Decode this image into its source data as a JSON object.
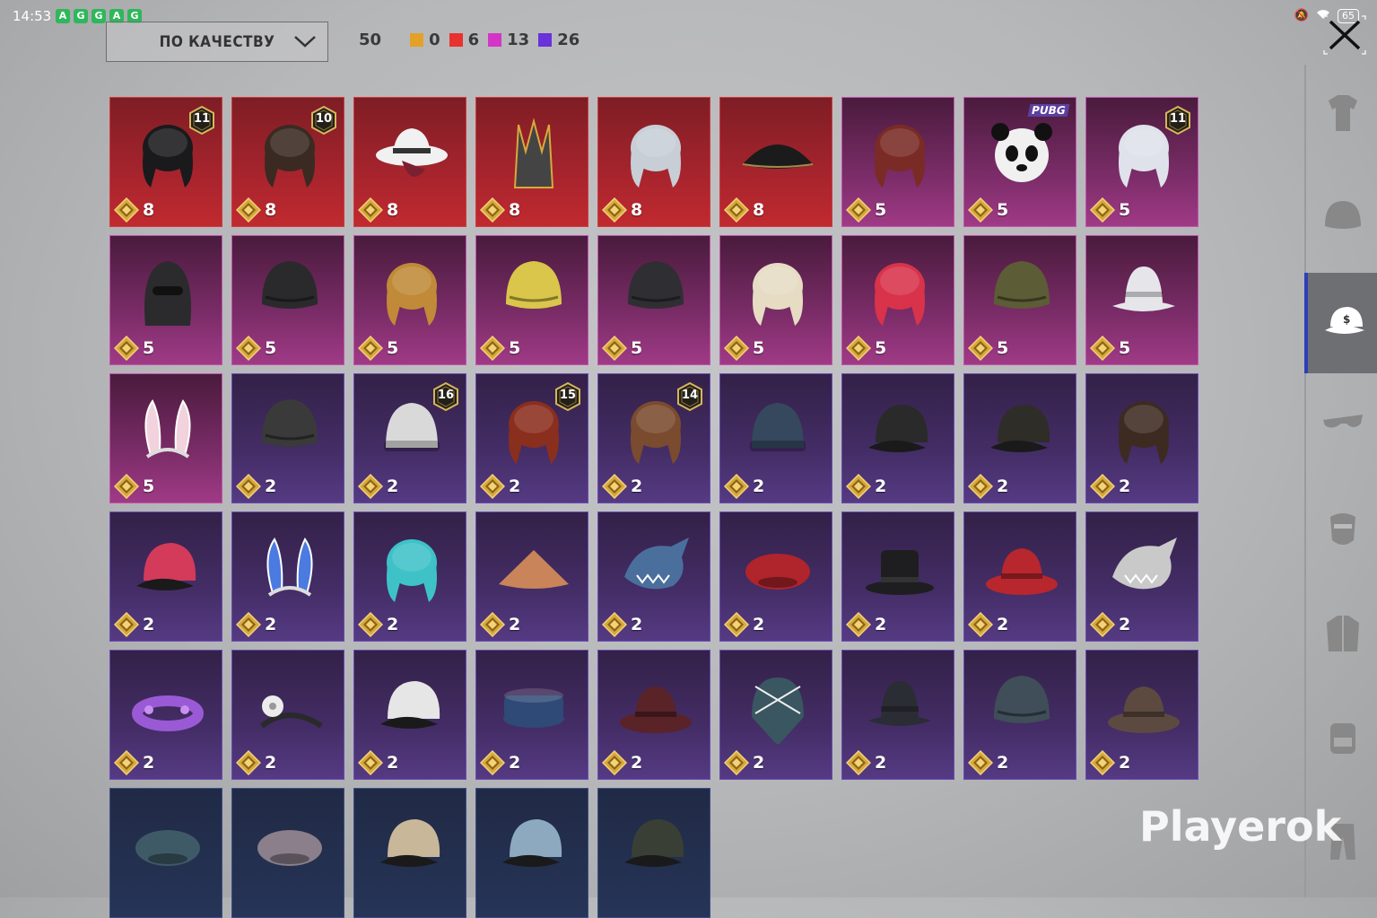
{
  "status_bar": {
    "time": "14:53",
    "app_icons": [
      "A",
      "G",
      "G",
      "A",
      "G"
    ],
    "battery": "65"
  },
  "sort": {
    "label": "ПО КАЧЕСТВУ"
  },
  "counts": {
    "total": "50",
    "groups": [
      {
        "color": "#e3a128",
        "value": "0"
      },
      {
        "color": "#e8322f",
        "value": "6"
      },
      {
        "color": "#d435c6",
        "value": "13"
      },
      {
        "color": "#6a32d8",
        "value": "26"
      }
    ]
  },
  "watermark": "Playerok",
  "sidebar": {
    "items": [
      {
        "icon": "shirt-icon",
        "active": false
      },
      {
        "icon": "helmet-icon",
        "active": false
      },
      {
        "icon": "cap-icon",
        "active": true
      },
      {
        "icon": "glasses-icon",
        "active": false
      },
      {
        "icon": "mask-icon",
        "active": false
      },
      {
        "icon": "jacket-icon",
        "active": false
      },
      {
        "icon": "backpack-icon",
        "active": false
      },
      {
        "icon": "pants-icon",
        "active": false
      }
    ]
  },
  "items": [
    {
      "q": "red",
      "price": "8",
      "level": "11",
      "art": "hair",
      "color": "#1a1a1c"
    },
    {
      "q": "red",
      "price": "8",
      "level": "10",
      "art": "hair",
      "color": "#3a2a22"
    },
    {
      "q": "red",
      "price": "8",
      "art": "widehat",
      "color": "#f1f1f1"
    },
    {
      "q": "red",
      "price": "8",
      "art": "crown",
      "color": "#444"
    },
    {
      "q": "red",
      "price": "8",
      "art": "hair",
      "color": "#c8ced6"
    },
    {
      "q": "red",
      "price": "8",
      "art": "tricorn",
      "color": "#1b1b1b"
    },
    {
      "q": "pink",
      "price": "5",
      "art": "hair",
      "color": "#7a2b25"
    },
    {
      "q": "pink",
      "price": "5",
      "tag": "PUBG",
      "art": "panda",
      "color": "#f0f0f0"
    },
    {
      "q": "pink",
      "price": "5",
      "level": "11",
      "art": "hair",
      "color": "#dfe2ea"
    },
    {
      "q": "pink",
      "price": "5",
      "art": "balaclava",
      "color": "#2b2b2d"
    },
    {
      "q": "pink",
      "price": "5",
      "art": "helmet",
      "color": "#2a2a2c"
    },
    {
      "q": "pink",
      "price": "5",
      "art": "hair",
      "color": "#c08a38"
    },
    {
      "q": "pink",
      "price": "5",
      "art": "helmet",
      "color": "#d9c64a"
    },
    {
      "q": "pink",
      "price": "5",
      "art": "helmet",
      "color": "#2f2f33"
    },
    {
      "q": "pink",
      "price": "5",
      "art": "hair",
      "color": "#e6dcc4"
    },
    {
      "q": "pink",
      "price": "5",
      "art": "hair",
      "color": "#d8334a"
    },
    {
      "q": "pink",
      "price": "5",
      "art": "helmet",
      "color": "#5c5c36"
    },
    {
      "q": "pink",
      "price": "5",
      "art": "bucket",
      "color": "#e6e6ea"
    },
    {
      "q": "pink",
      "price": "5",
      "art": "ears",
      "color": "#f2d2dc"
    },
    {
      "q": "purple",
      "price": "2",
      "art": "helmet",
      "color": "#3a3a3a"
    },
    {
      "q": "purple",
      "price": "2",
      "level": "16",
      "art": "beanie",
      "color": "#d9d9d9"
    },
    {
      "q": "purple",
      "price": "2",
      "level": "15",
      "art": "hair",
      "color": "#8a2e1e"
    },
    {
      "q": "purple",
      "price": "2",
      "level": "14",
      "art": "hair",
      "color": "#7a4b2e"
    },
    {
      "q": "purple",
      "price": "2",
      "art": "beanie",
      "color": "#35485e"
    },
    {
      "q": "purple",
      "price": "2",
      "art": "cap",
      "color": "#2a2a2a"
    },
    {
      "q": "purple",
      "price": "2",
      "art": "cap",
      "color": "#2f2d28"
    },
    {
      "q": "purple",
      "price": "2",
      "art": "hair",
      "color": "#3d2b22"
    },
    {
      "q": "purple",
      "price": "2",
      "art": "cap",
      "color": "#d43a5a"
    },
    {
      "q": "purple",
      "price": "2",
      "art": "ears",
      "color": "#4b7be0"
    },
    {
      "q": "purple",
      "price": "2",
      "art": "hair",
      "color": "#3ec2c7"
    },
    {
      "q": "purple",
      "price": "2",
      "art": "cone",
      "color": "#c98459"
    },
    {
      "q": "purple",
      "price": "2",
      "art": "shark",
      "color": "#4b6f9c"
    },
    {
      "q": "purple",
      "price": "2",
      "art": "beret",
      "color": "#b0242b"
    },
    {
      "q": "purple",
      "price": "2",
      "art": "tophat",
      "color": "#1e1e20"
    },
    {
      "q": "purple",
      "price": "2",
      "art": "fedora",
      "color": "#b7272d"
    },
    {
      "q": "purple",
      "price": "2",
      "art": "shark",
      "color": "#c9c9c9"
    },
    {
      "q": "purple",
      "price": "2",
      "art": "wreath",
      "color": "#9a5ad6"
    },
    {
      "q": "purple",
      "price": "2",
      "art": "band",
      "color": "#2a2a2a"
    },
    {
      "q": "purple",
      "price": "2",
      "art": "cap",
      "color": "#e6e6e6"
    },
    {
      "q": "purple",
      "price": "2",
      "art": "pillbox",
      "color": "#2f4a76"
    },
    {
      "q": "purple",
      "price": "2",
      "art": "fedora",
      "color": "#5a2328"
    },
    {
      "q": "purple",
      "price": "2",
      "art": "bandana",
      "color": "#3a5660"
    },
    {
      "q": "purple",
      "price": "2",
      "art": "bucket",
      "color": "#2a2d33"
    },
    {
      "q": "purple",
      "price": "2",
      "art": "helmet",
      "color": "#3f4e58"
    },
    {
      "q": "purple",
      "price": "2",
      "art": "fedora",
      "color": "#5c4a40"
    },
    {
      "q": "blue",
      "art": "beret",
      "color": "#3e5a66"
    },
    {
      "q": "blue",
      "art": "beret",
      "color": "#8a7f8a"
    },
    {
      "q": "blue",
      "art": "cap",
      "color": "#c9b79a"
    },
    {
      "q": "blue",
      "art": "cap",
      "color": "#8da9c0"
    },
    {
      "q": "blue",
      "art": "cap",
      "color": "#3a3f36"
    }
  ]
}
